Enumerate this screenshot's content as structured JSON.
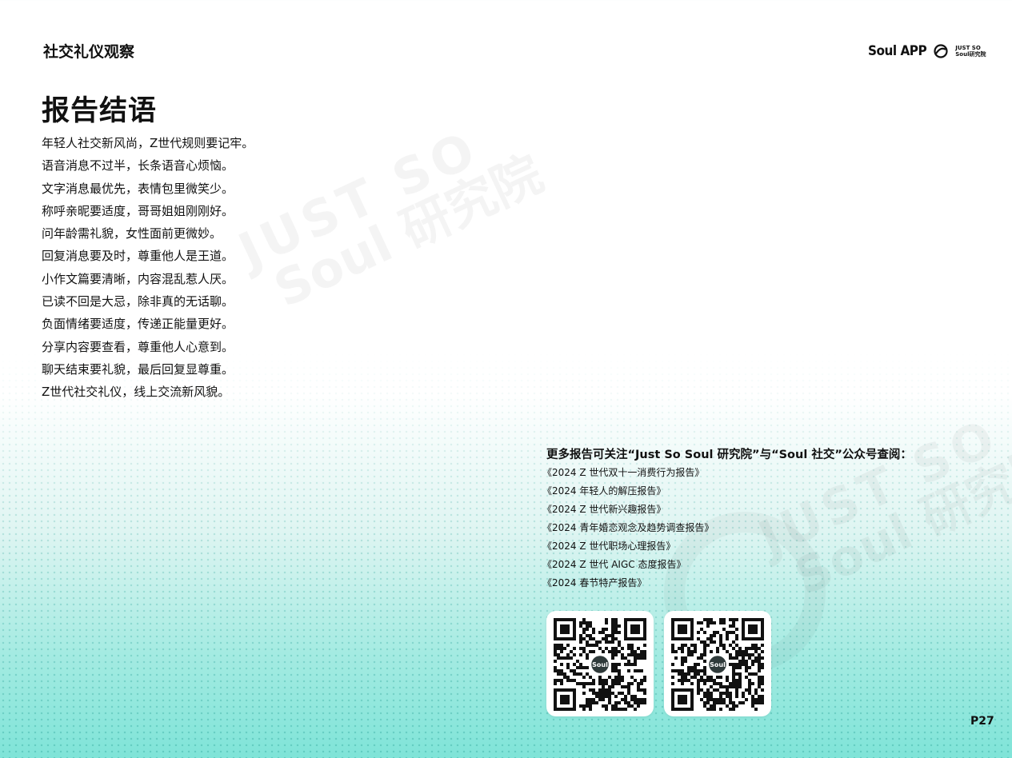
{
  "header": {
    "section_label": "社交礼仪观察",
    "brand_logo_text": "Soul APP",
    "brand_sub_line1": "JUST SO",
    "brand_sub_line2": "Soul研究院"
  },
  "watermark": {
    "line1": "JUST SO",
    "line2": "Soul 研究院"
  },
  "conclusion": {
    "title": "报告结语",
    "lines": [
      "年轻人社交新风尚，Z世代规则要记牢。",
      "语音消息不过半，长条语音心烦恼。",
      "文字消息最优先，表情包里微笑少。",
      "称呼亲昵要适度，哥哥姐姐刚刚好。",
      "问年龄需礼貌，女性面前更微妙。",
      "回复消息要及时，尊重他人是王道。",
      "小作文篇要清晰，内容混乱惹人厌。",
      "已读不回是大忌，除非真的无话聊。",
      "负面情绪要适度，传递正能量更好。",
      "分享内容要查看，尊重他人心意到。",
      "聊天结束要礼貌，最后回复显尊重。",
      "Z世代社交礼仪，线上交流新风貌。"
    ]
  },
  "more_reports": {
    "heading": "更多报告可关注“Just So Soul 研究院”与“Soul 社交”公众号查阅：",
    "items": [
      "《2024 Z 世代双十一消费行为报告》",
      "《2024 年轻人的解压报告》",
      "《2024 Z 世代新兴趣报告》",
      "《2024 青年婚恋观念及趋势调查报告》",
      "《2024 Z 世代职场心理报告》",
      "《2024 Z 世代 AIGC 态度报告》",
      "《2024 春节特产报告》"
    ]
  },
  "qr_codes": {
    "center_label": "Soul"
  },
  "page_number": "P27",
  "colors": {
    "text": "#111111",
    "gradient_bottom": "#7fe4d8",
    "qr_center": "#2f3a3a"
  }
}
